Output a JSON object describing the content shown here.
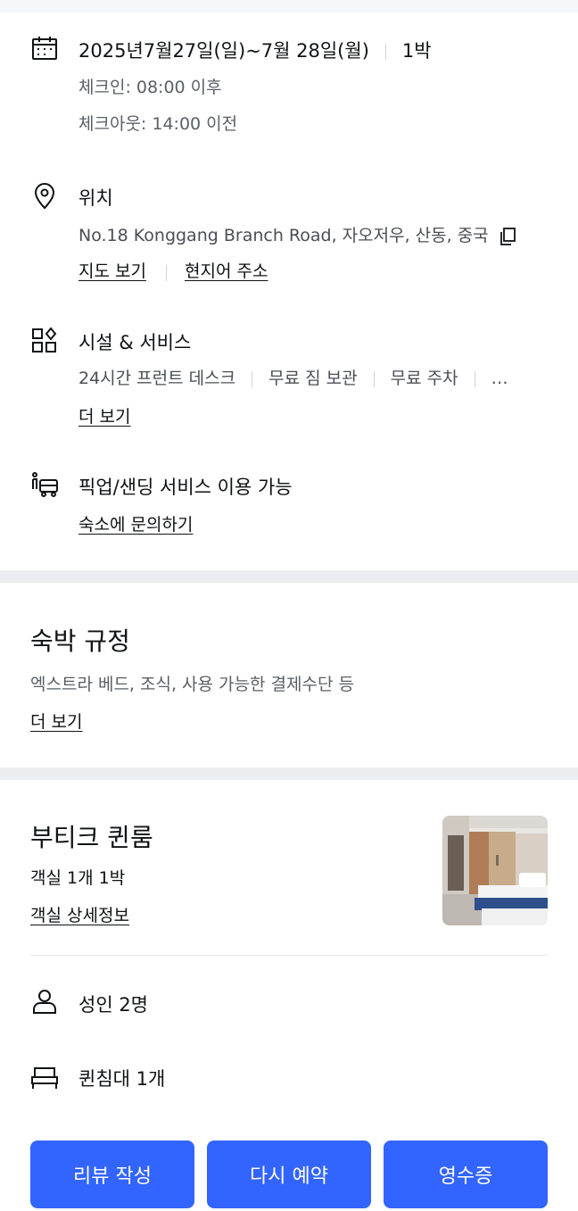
{
  "stay": {
    "dates": "2025년7월27일(일)~7월 28일(월)",
    "nights": "1박",
    "checkin": "체크인: 08:00 이후",
    "checkout": "체크아웃: 14:00 이전"
  },
  "location": {
    "title": "위치",
    "address": "No.18 Konggang Branch Road, 자오저우, 산동, 중국",
    "map_link": "지도 보기",
    "local_address_link": "현지어 주소"
  },
  "facilities": {
    "title": "시설 & 서비스",
    "items": [
      "24시간 프런트 데스크",
      "무료 짐 보관",
      "무료 주차"
    ],
    "more_glyph": "…",
    "more_link": "더 보기"
  },
  "pickup": {
    "title": "픽업/샌딩 서비스 이용 가능",
    "contact_link": "숙소에 문의하기"
  },
  "policy": {
    "title": "숙박 규정",
    "subtitle": "엑스트라 베드, 조식, 사용 가능한 결제수단 등",
    "more_link": "더 보기"
  },
  "room": {
    "name": "부티크 퀸룸",
    "summary": "객실 1개 1박",
    "detail_link": "객실 상세정보",
    "guests": "성인 2명",
    "bed": "퀸침대 1개"
  },
  "buttons": {
    "review": "리뷰 작성",
    "rebook": "다시 예약",
    "receipt": "영수증"
  },
  "colors": {
    "accent": "#3264ff",
    "text": "#0f1214",
    "muted": "#5a5f66",
    "divider": "#ebedf0"
  },
  "icons": {
    "calendar": "calendar-icon",
    "location": "map-pin-icon",
    "copy": "copy-icon",
    "facilities": "facilities-icon",
    "pickup": "shuttle-icon",
    "guest": "person-icon",
    "bed": "bed-icon"
  }
}
